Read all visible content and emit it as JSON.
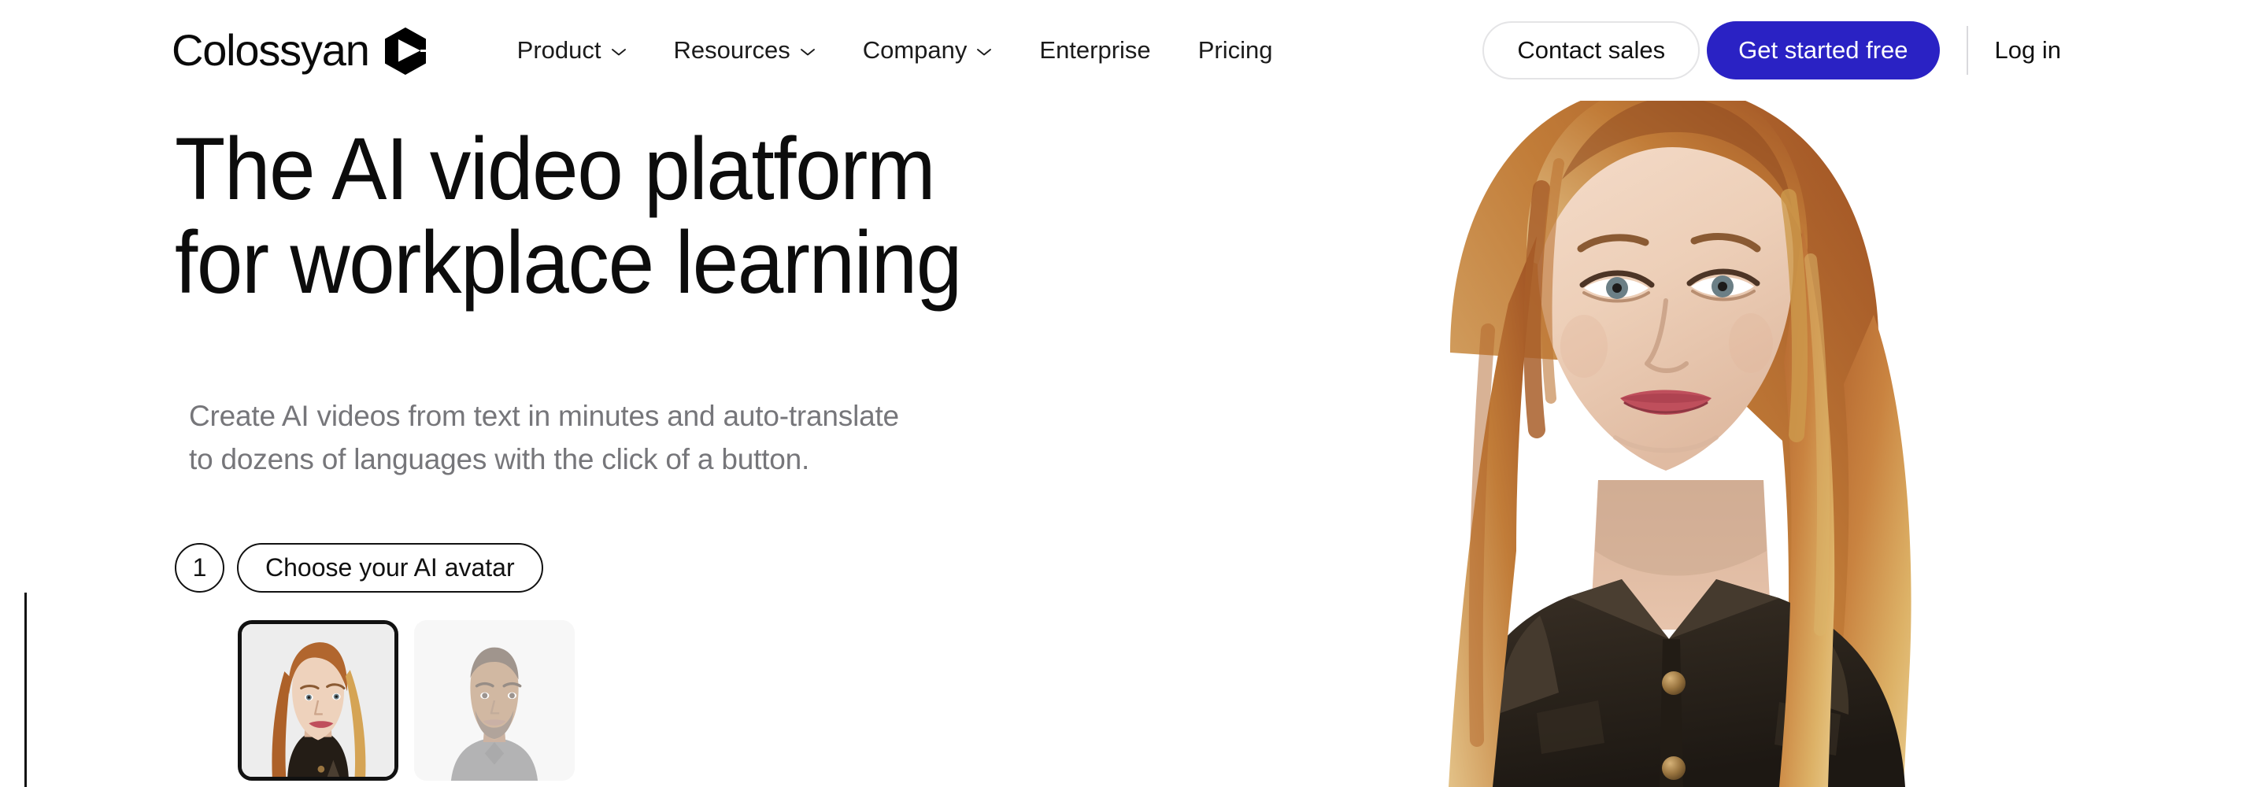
{
  "brand": {
    "name": "Colossyan",
    "mark_icon": "hexagon-play-icon"
  },
  "nav": {
    "items": [
      {
        "label": "Product",
        "has_dropdown": true,
        "icon": "chevron-down-icon"
      },
      {
        "label": "Resources",
        "has_dropdown": true,
        "icon": "chevron-down-icon"
      },
      {
        "label": "Company",
        "has_dropdown": true,
        "icon": "chevron-down-icon"
      },
      {
        "label": "Enterprise",
        "has_dropdown": false,
        "icon": ""
      },
      {
        "label": "Pricing",
        "has_dropdown": false,
        "icon": ""
      }
    ]
  },
  "header_actions": {
    "contact_sales_label": "Contact sales",
    "get_started_label": "Get started free",
    "login_label": "Log in",
    "primary_color": "#2a22c4",
    "outline_border_color": "#e4e4e6",
    "divider_color": "#d9d9dd"
  },
  "hero": {
    "headline_line_1": "The AI video platform",
    "headline_line_2": "for workplace learning",
    "subhead_line_1": "Create AI videos from text in minutes and auto-translate",
    "subhead_line_2": "to dozens of languages with the click of a button.",
    "headline_color": "#0c0c0c",
    "subhead_color": "#76767a"
  },
  "builder": {
    "step_number": "1",
    "step_label": "Choose your AI avatar",
    "avatars": [
      {
        "name": "female-avatar-red-hair",
        "selected": true,
        "alt": "Woman with long reddish-blonde hair in a dark jacket"
      },
      {
        "name": "male-avatar-short-hair",
        "selected": false,
        "alt": "Man with short hair and beard in a grey v-neck shirt"
      }
    ]
  },
  "hero_image": {
    "name": "ai-avatar-presenter",
    "description": "Woman with long reddish-blonde hair wearing a dark brown button-up jacket, smiling on a white background"
  }
}
